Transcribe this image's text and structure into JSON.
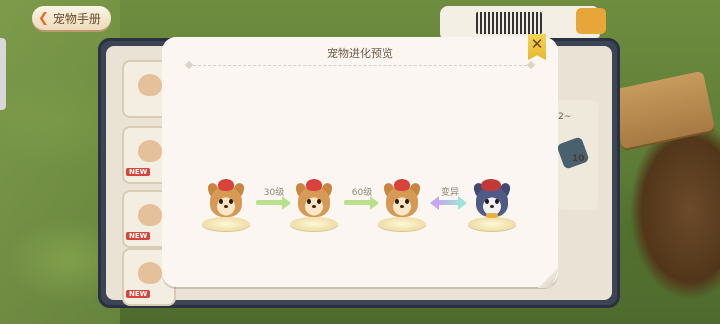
{
  "header": {
    "back_label": "宠物手册"
  },
  "modal": {
    "title": "宠物进化预览",
    "close_icon": "close-icon"
  },
  "evolution": {
    "stages": [
      {
        "name": "stage-1",
        "icon": "shiba-pet-icon"
      },
      {
        "name": "stage-2",
        "icon": "shiba-pet-icon"
      },
      {
        "name": "stage-3",
        "icon": "shiba-pet-icon"
      },
      {
        "name": "stage-mutation",
        "icon": "blue-wolf-pet-icon"
      }
    ],
    "links": [
      {
        "label": "30级"
      },
      {
        "label": "60级"
      },
      {
        "label": "变异"
      }
    ]
  },
  "background": {
    "card_tags": [
      "NEW",
      "NEW",
      "NEW"
    ],
    "right_panel_text": "2~",
    "item_count": "10"
  },
  "colors": {
    "level_arrow": "#b9e08a",
    "mutation_arrow_start": "#c5a6f0",
    "mutation_arrow_end": "#9fe3d8",
    "close_button": "#e6b830"
  }
}
